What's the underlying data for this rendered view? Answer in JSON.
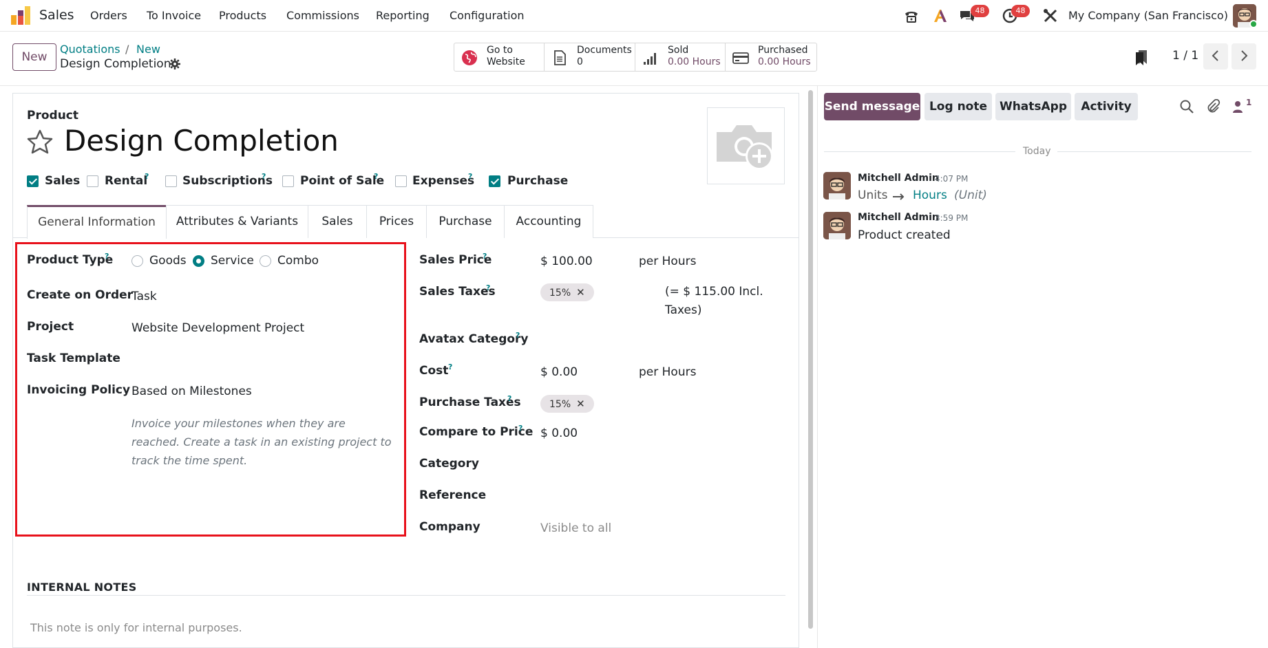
{
  "navbar": {
    "app_name": "Sales",
    "menu": [
      "Orders",
      "To Invoice",
      "Products",
      "Commissions",
      "Reporting",
      "Configuration"
    ],
    "messages_badge": "48",
    "activities_badge": "48",
    "company": "My Company (San Francisco)"
  },
  "control": {
    "new_label": "New",
    "breadcrumb": [
      "Quotations",
      "New"
    ],
    "breadcrumb_sep": "/",
    "record_title": "Design Completion",
    "smart_buttons": [
      {
        "line1": "Go to",
        "line2": "Website"
      },
      {
        "line1": "Documents",
        "line2": "0"
      },
      {
        "line1": "Sold",
        "line2": "0.00 Hours"
      },
      {
        "line1": "Purchased",
        "line2": "0.00 Hours"
      }
    ],
    "pager": "1 / 1"
  },
  "form": {
    "product_label": "Product",
    "product_name": "Design Completion",
    "checkboxes": [
      {
        "label": "Sales",
        "checked": true,
        "help": false
      },
      {
        "label": "Rental",
        "checked": false,
        "help": true
      },
      {
        "label": "Subscriptions",
        "checked": false,
        "help": true
      },
      {
        "label": "Point of Sale",
        "checked": false,
        "help": true
      },
      {
        "label": "Expenses",
        "checked": false,
        "help": true
      },
      {
        "label": "Purchase",
        "checked": true,
        "help": false
      }
    ],
    "help_mark": "?",
    "tabs": [
      "General Information",
      "Attributes & Variants",
      "Sales",
      "Prices",
      "Purchase",
      "Accounting"
    ],
    "left": {
      "product_type_label": "Product Type",
      "product_type_options": [
        "Goods",
        "Service",
        "Combo"
      ],
      "product_type_selected": "Service",
      "create_on_order_label": "Create on Order",
      "create_on_order_value": "Task",
      "project_label": "Project",
      "project_value": "Website Development Project",
      "task_template_label": "Task Template",
      "invoicing_policy_label": "Invoicing Policy",
      "invoicing_policy_value": "Based on Milestones",
      "invoicing_help": "Invoice your milestones when they are reached. Create a task in an existing project to track the time spent."
    },
    "right": {
      "sales_price_label": "Sales Price",
      "sales_price_value": "$ 100.00",
      "sales_price_uom": "per Hours",
      "sales_taxes_label": "Sales Taxes",
      "sales_taxes_tag": "15%",
      "sales_taxes_incl_1": "(= $ 115.00 Incl.",
      "sales_taxes_incl_2": "Taxes)",
      "avatax_label": "Avatax Category",
      "cost_label": "Cost",
      "cost_value": "$ 0.00",
      "cost_uom": "per Hours",
      "purchase_taxes_label": "Purchase Taxes",
      "purchase_taxes_tag": "15%",
      "compare_label": "Compare to Price",
      "compare_value": "$ 0.00",
      "category_label": "Category",
      "reference_label": "Reference",
      "company_label": "Company",
      "company_value": "Visible to all"
    },
    "notes_title": "INTERNAL NOTES",
    "notes_placeholder": "This note is only for internal purposes."
  },
  "chatter": {
    "send_message": "Send message",
    "log_note": "Log note",
    "whatsapp": "WhatsApp",
    "activity": "Activity",
    "followers_count": "1",
    "today": "Today",
    "messages": [
      {
        "author": "Mitchell Admin",
        "time": "4:07 PM",
        "from": "Units",
        "to": "Hours",
        "field": "(Unit)"
      },
      {
        "author": "Mitchell Admin",
        "time": "3:59 PM",
        "body": "Product created"
      }
    ]
  },
  "colors": {
    "brand": "#714b67",
    "accent": "#017e84",
    "highlight_box": "#e8111b",
    "badge": "#e04040"
  }
}
